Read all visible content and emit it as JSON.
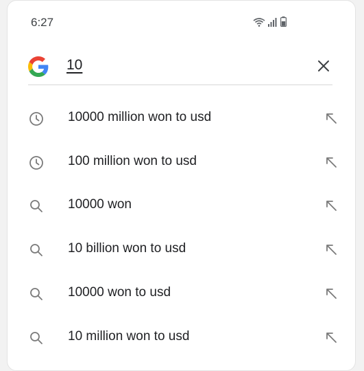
{
  "status_bar": {
    "time": "6:27",
    "icons": [
      "wifi-icon",
      "signal-icon",
      "battery-icon"
    ]
  },
  "search": {
    "logo": "google-g-logo",
    "query": "10",
    "clear_icon": "close-icon"
  },
  "suggestions": [
    {
      "icon": "history-icon",
      "text": "10000 million won to usd",
      "action_icon": "arrow-up-left-icon"
    },
    {
      "icon": "history-icon",
      "text": "100 million won to usd",
      "action_icon": "arrow-up-left-icon"
    },
    {
      "icon": "search-icon",
      "text": "10000 won",
      "action_icon": "arrow-up-left-icon"
    },
    {
      "icon": "search-icon",
      "text": "10 billion won to usd",
      "action_icon": "arrow-up-left-icon"
    },
    {
      "icon": "search-icon",
      "text": "10000 won to usd",
      "action_icon": "arrow-up-left-icon"
    },
    {
      "icon": "search-icon",
      "text": "10 million won to usd",
      "action_icon": "arrow-up-left-icon"
    }
  ],
  "colors": {
    "icon_gray": "#7a7a7a",
    "text": "#202124",
    "google_blue": "#4285F4",
    "google_red": "#EA4335",
    "google_yellow": "#FBBC05",
    "google_green": "#34A853"
  }
}
